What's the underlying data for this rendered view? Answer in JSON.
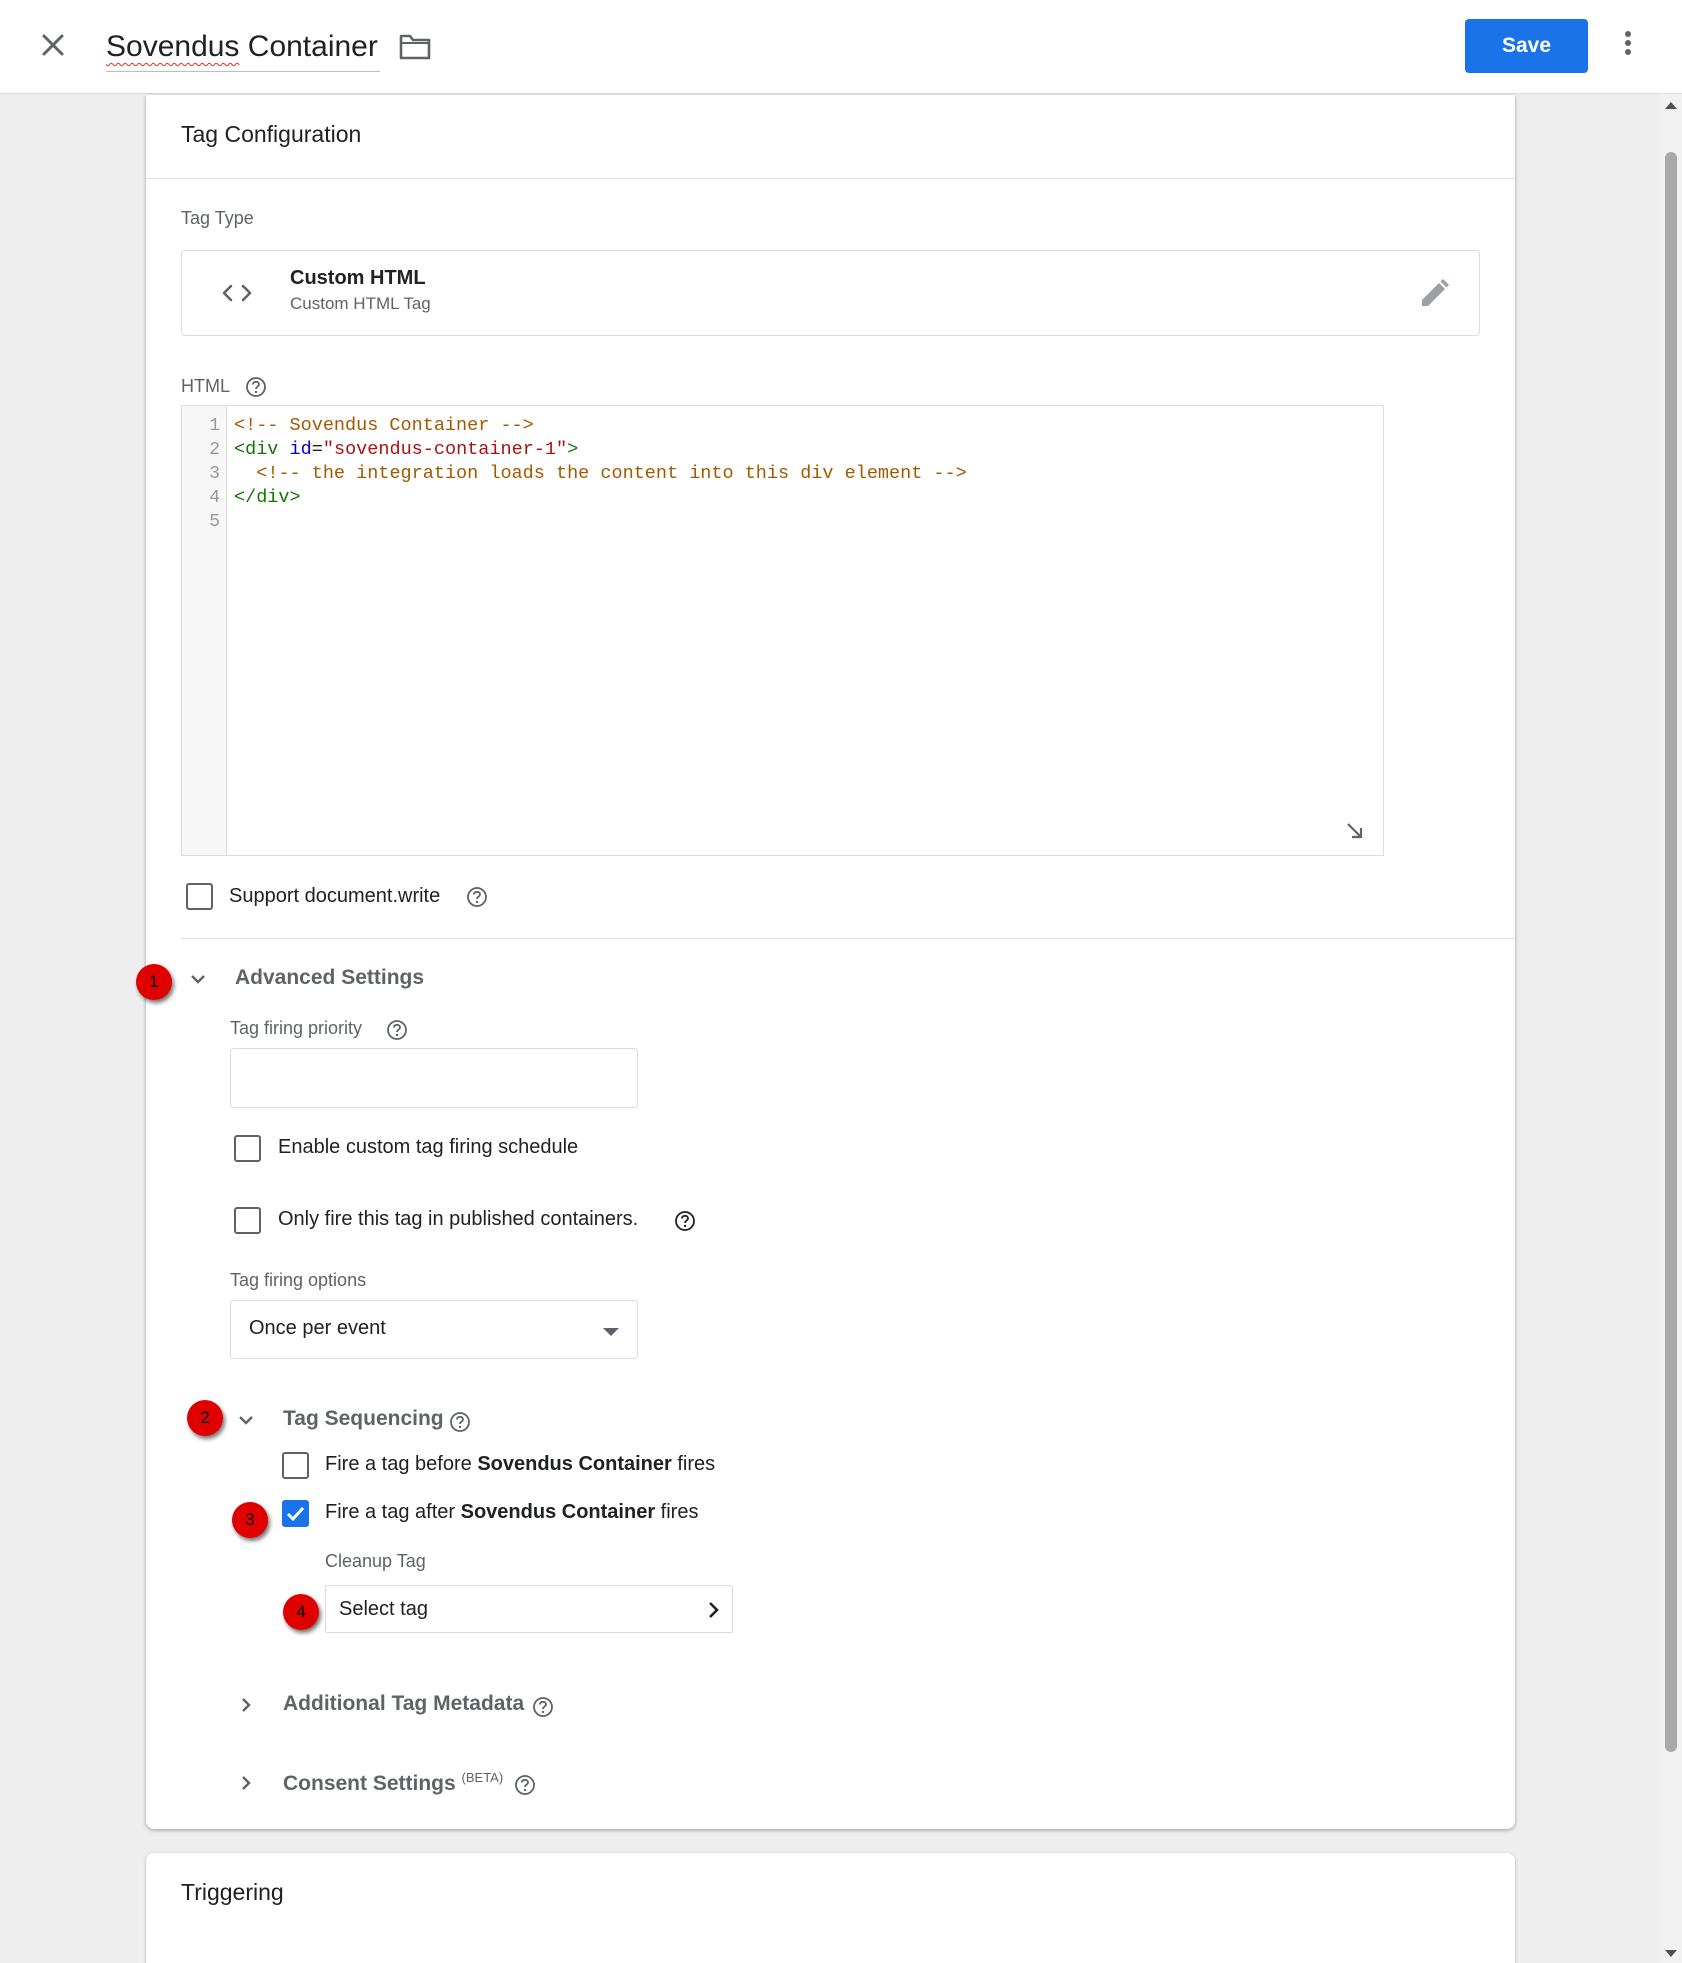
{
  "header": {
    "title_first": "Sovendus",
    "title_rest": " Container",
    "save_label": "Save"
  },
  "tag_config": {
    "card_title": "Tag Configuration",
    "tag_type_label": "Tag Type",
    "tag_type_name": "Custom HTML",
    "tag_type_desc": "Custom HTML Tag",
    "html_label": "HTML",
    "code_lines": [
      "<!-- Sovendus Container -->",
      "<div id=\"sovendus-container-1\">",
      "  <!-- the integration loads the content into this div element -->",
      "</div>",
      ""
    ],
    "line_numbers": [
      "1",
      "2",
      "3",
      "4",
      "5"
    ],
    "support_docwrite_label": "Support document.write",
    "support_docwrite_checked": false
  },
  "advanced": {
    "title": "Advanced Settings",
    "firing_priority_label": "Tag firing priority",
    "firing_priority_value": "",
    "custom_schedule_label": "Enable custom tag firing schedule",
    "custom_schedule_checked": false,
    "published_only_label": "Only fire this tag in published containers.",
    "published_only_checked": false,
    "firing_options_label": "Tag firing options",
    "firing_options_value": "Once per event"
  },
  "sequencing": {
    "title": "Tag Sequencing",
    "before_pre": "Fire a tag before ",
    "before_bold": "Sovendus Container",
    "before_post": " fires",
    "before_checked": false,
    "after_pre": "Fire a tag after ",
    "after_bold": "Sovendus Container",
    "after_post": " fires",
    "after_checked": true,
    "cleanup_label": "Cleanup Tag",
    "cleanup_value": "Select tag"
  },
  "metadata": {
    "title": "Additional Tag Metadata"
  },
  "consent": {
    "title": "Consent Settings",
    "badge": "(BETA)"
  },
  "triggering": {
    "title": "Triggering"
  },
  "markers": [
    "1",
    "2",
    "3",
    "4"
  ],
  "colors": {
    "accent": "#1a73e8",
    "marker": "#e00000"
  }
}
